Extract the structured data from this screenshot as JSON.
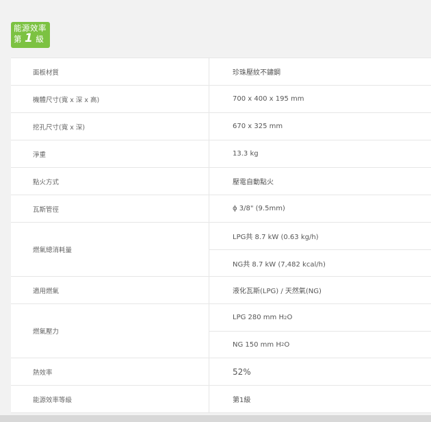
{
  "badge": {
    "line1": "能源效率",
    "line2_prefix": "第",
    "line2_number": "1",
    "line2_suffix": "級"
  },
  "colors": {
    "badge_bg": "#7cc242",
    "border": "#e6e6e6",
    "page_bg": "#f2f2f2"
  },
  "specs": [
    {
      "label": "面板材質",
      "values": [
        "珍珠壓紋不鏽鋼"
      ]
    },
    {
      "label": "機體尺寸(寬 x 深 x 高)",
      "values": [
        "700 x 400 x 195 mm"
      ]
    },
    {
      "label": "挖孔尺寸(寬 x 深)",
      "values": [
        "670 x 325 mm"
      ]
    },
    {
      "label": "淨重",
      "values": [
        "13.3 kg"
      ]
    },
    {
      "label": "點火方式",
      "values": [
        "壓電自動點火"
      ]
    },
    {
      "label": "瓦斯管徑",
      "values": [
        "ϕ 3/8\" (9.5mm)"
      ]
    },
    {
      "label": "燃氣總消耗量",
      "values": [
        "LPG共 8.7 kW (0.63 kg/h)",
        "NG共 8.7 kW (7,482 kcal/h)"
      ]
    },
    {
      "label": "適用燃氣",
      "values": [
        "液化瓦斯(LPG) / 天然氣(NG)"
      ]
    },
    {
      "label": "燃氣壓力",
      "values": [
        "LPG 280 mm H",
        "NG 150 mm H"
      ],
      "value_sub": [
        "2",
        "2"
      ],
      "value_tail": [
        "O",
        "O"
      ]
    },
    {
      "label": "熱效率",
      "values": [
        "52%"
      ]
    },
    {
      "label": "能源效率等級",
      "values": [
        "第1級"
      ]
    }
  ]
}
